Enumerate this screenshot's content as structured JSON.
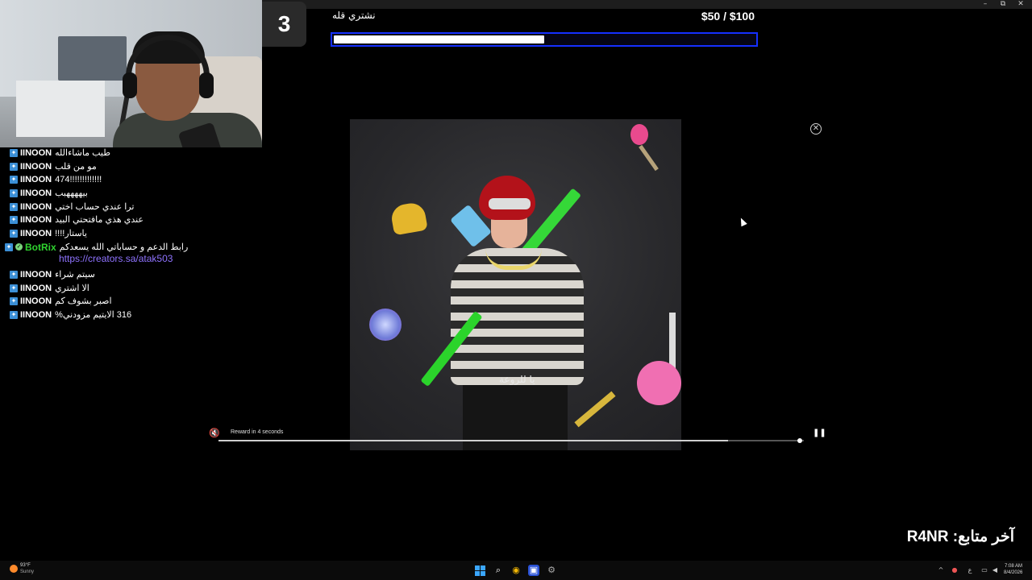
{
  "window": {
    "minimize": "–",
    "maximize": "⧉",
    "close": "✕"
  },
  "goal": {
    "number": "3",
    "title": "نشتري قله",
    "amount": "$50 / $100",
    "progress": 0.5,
    "bar_color": "#1530ff"
  },
  "chat": {
    "messages": [
      {
        "user": "IINOON",
        "text": "طيب ماشاءالله"
      },
      {
        "user": "IINOON",
        "text": "مو من قلب"
      },
      {
        "user": "IINOON",
        "text": "474!!!!!!!!!!!!!"
      },
      {
        "user": "IINOON",
        "text": "بيههههبب"
      },
      {
        "user": "IINOON",
        "text": "ترا عندي حساب اختي"
      },
      {
        "user": "IINOON",
        "text": "عندي هذي مافتحتي البيد"
      },
      {
        "user": "IINOON",
        "text": "ياستار!!!!"
      }
    ],
    "bot": {
      "user": "BotRix",
      "text": "رابط الدعم و حساباتي الله يسعدكم",
      "link": "https://creators.sa/atak503"
    },
    "messages_after": [
      {
        "user": "IINOON",
        "text": "سيتم شراء"
      },
      {
        "user": "IINOON",
        "text": "الا اشتري"
      },
      {
        "user": "IINOON",
        "text": "اصبر بشوف كم"
      },
      {
        "user": "IINOON",
        "text": "316 الايتيم مزودني%"
      }
    ]
  },
  "ad": {
    "caption": "يا للروعة",
    "reward_text": "Reward in 4 seconds",
    "progress": 0.87,
    "mute_icon": "speaker-muted-icon",
    "pause_icon": "pause-icon",
    "close_icon": "close-circle-icon"
  },
  "follower": {
    "text": "آخر متابع: R4NR"
  },
  "taskbar": {
    "weather_temp": "93°F",
    "weather_cond": "Sunny",
    "time": "7:08 AM",
    "date": "8/4/2026",
    "lang": "ع"
  }
}
